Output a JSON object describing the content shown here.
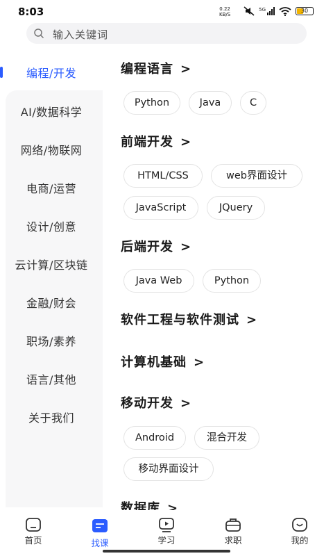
{
  "status": {
    "time": "8:03",
    "speed_top": "0.22",
    "speed_bottom": "KB/S",
    "network": "5G",
    "battery": "30"
  },
  "search": {
    "placeholder": "输入关键词"
  },
  "sidebar": {
    "items": [
      {
        "label": "编程/开发",
        "active": true
      },
      {
        "label": "AI/数据科学"
      },
      {
        "label": "网络/物联网"
      },
      {
        "label": "电商/运营"
      },
      {
        "label": "设计/创意"
      },
      {
        "label": "云计算/区块链"
      },
      {
        "label": "金融/财会"
      },
      {
        "label": "职场/素养"
      },
      {
        "label": "语言/其他"
      },
      {
        "label": "关于我们"
      }
    ]
  },
  "sections": [
    {
      "title": "编程语言",
      "tags": [
        "Python",
        "Java",
        "C"
      ]
    },
    {
      "title": "前端开发",
      "tags": [
        "HTML/CSS",
        "web界面设计",
        "JavaScript",
        "JQuery"
      ]
    },
    {
      "title": "后端开发",
      "tags": [
        "Java Web",
        "Python"
      ]
    },
    {
      "title": "软件工程与软件测试",
      "tags": []
    },
    {
      "title": "计算机基础",
      "tags": []
    },
    {
      "title": "移动开发",
      "tags": [
        "Android",
        "混合开发",
        "移动界面设计"
      ]
    },
    {
      "title": "数据库",
      "tags": []
    }
  ],
  "chevron": ">",
  "tabbar": {
    "items": [
      {
        "label": "首页",
        "icon": "home-icon"
      },
      {
        "label": "找课",
        "icon": "find-course-icon",
        "active": true
      },
      {
        "label": "学习",
        "icon": "study-play-icon"
      },
      {
        "label": "求职",
        "icon": "briefcase-icon"
      },
      {
        "label": "我的",
        "icon": "profile-smile-icon"
      }
    ]
  },
  "colors": {
    "accent": "#2b5cff",
    "sidebar_bg": "#f7f7f8",
    "search_bg": "#f3f3f5"
  }
}
